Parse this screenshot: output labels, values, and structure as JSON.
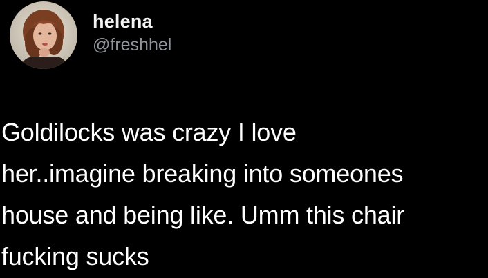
{
  "tweet": {
    "author": {
      "display_name": "helena",
      "handle": "@freshhel",
      "avatar_icon": "profile-photo"
    },
    "text": "Goldilocks was crazy I love\nher..imagine breaking into someones\nhouse and being like. Umm this chair\nfucking sucks"
  },
  "colors": {
    "background": "#000000",
    "text": "#ffffff",
    "handle": "#8f959b"
  }
}
